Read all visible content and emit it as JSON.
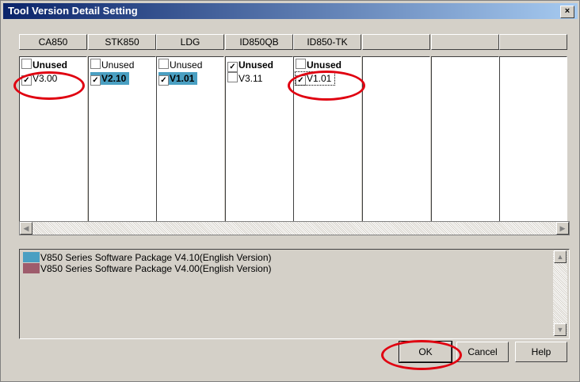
{
  "window": {
    "title": "Tool Version Detail Setting",
    "close_glyph": "×"
  },
  "columns": [
    {
      "header": "CA850",
      "items": [
        {
          "label": "Unused",
          "checked": false,
          "bold": true,
          "selected": false
        },
        {
          "label": "V3.00",
          "checked": true,
          "bold": false,
          "selected": false
        }
      ]
    },
    {
      "header": "STK850",
      "items": [
        {
          "label": "Unused",
          "checked": false,
          "bold": false,
          "selected": false
        },
        {
          "label": "V2.10",
          "checked": true,
          "bold": true,
          "selected": true
        }
      ]
    },
    {
      "header": "LDG",
      "items": [
        {
          "label": "Unused",
          "checked": false,
          "bold": false,
          "selected": false
        },
        {
          "label": "V1.01",
          "checked": true,
          "bold": true,
          "selected": true
        }
      ]
    },
    {
      "header": "ID850QB",
      "items": [
        {
          "label": "Unused",
          "checked": true,
          "bold": true,
          "selected": false
        },
        {
          "label": "V3.11",
          "checked": false,
          "bold": false,
          "selected": false
        }
      ]
    },
    {
      "header": "ID850-TK",
      "items": [
        {
          "label": "Unused",
          "checked": false,
          "bold": true,
          "selected": false
        },
        {
          "label": "V1.01",
          "checked": true,
          "bold": false,
          "selected": false,
          "focused": true
        }
      ]
    },
    {
      "header": "",
      "items": []
    },
    {
      "header": "",
      "items": []
    },
    {
      "header": "",
      "items": []
    }
  ],
  "packages": [
    {
      "label": "V850 Series Software Package V4.10(English Version)",
      "color": "#4a9fc2"
    },
    {
      "label": "V850 Series Software Package V4.00(English Version)",
      "color": "#9e5c6c"
    }
  ],
  "buttons": {
    "ok": "OK",
    "cancel": "Cancel",
    "help": "Help"
  },
  "colors": {
    "selection": "#4a9fc2",
    "annotation": "#e00010",
    "titlebar_start": "#0a246a"
  },
  "check_glyph": "✓"
}
